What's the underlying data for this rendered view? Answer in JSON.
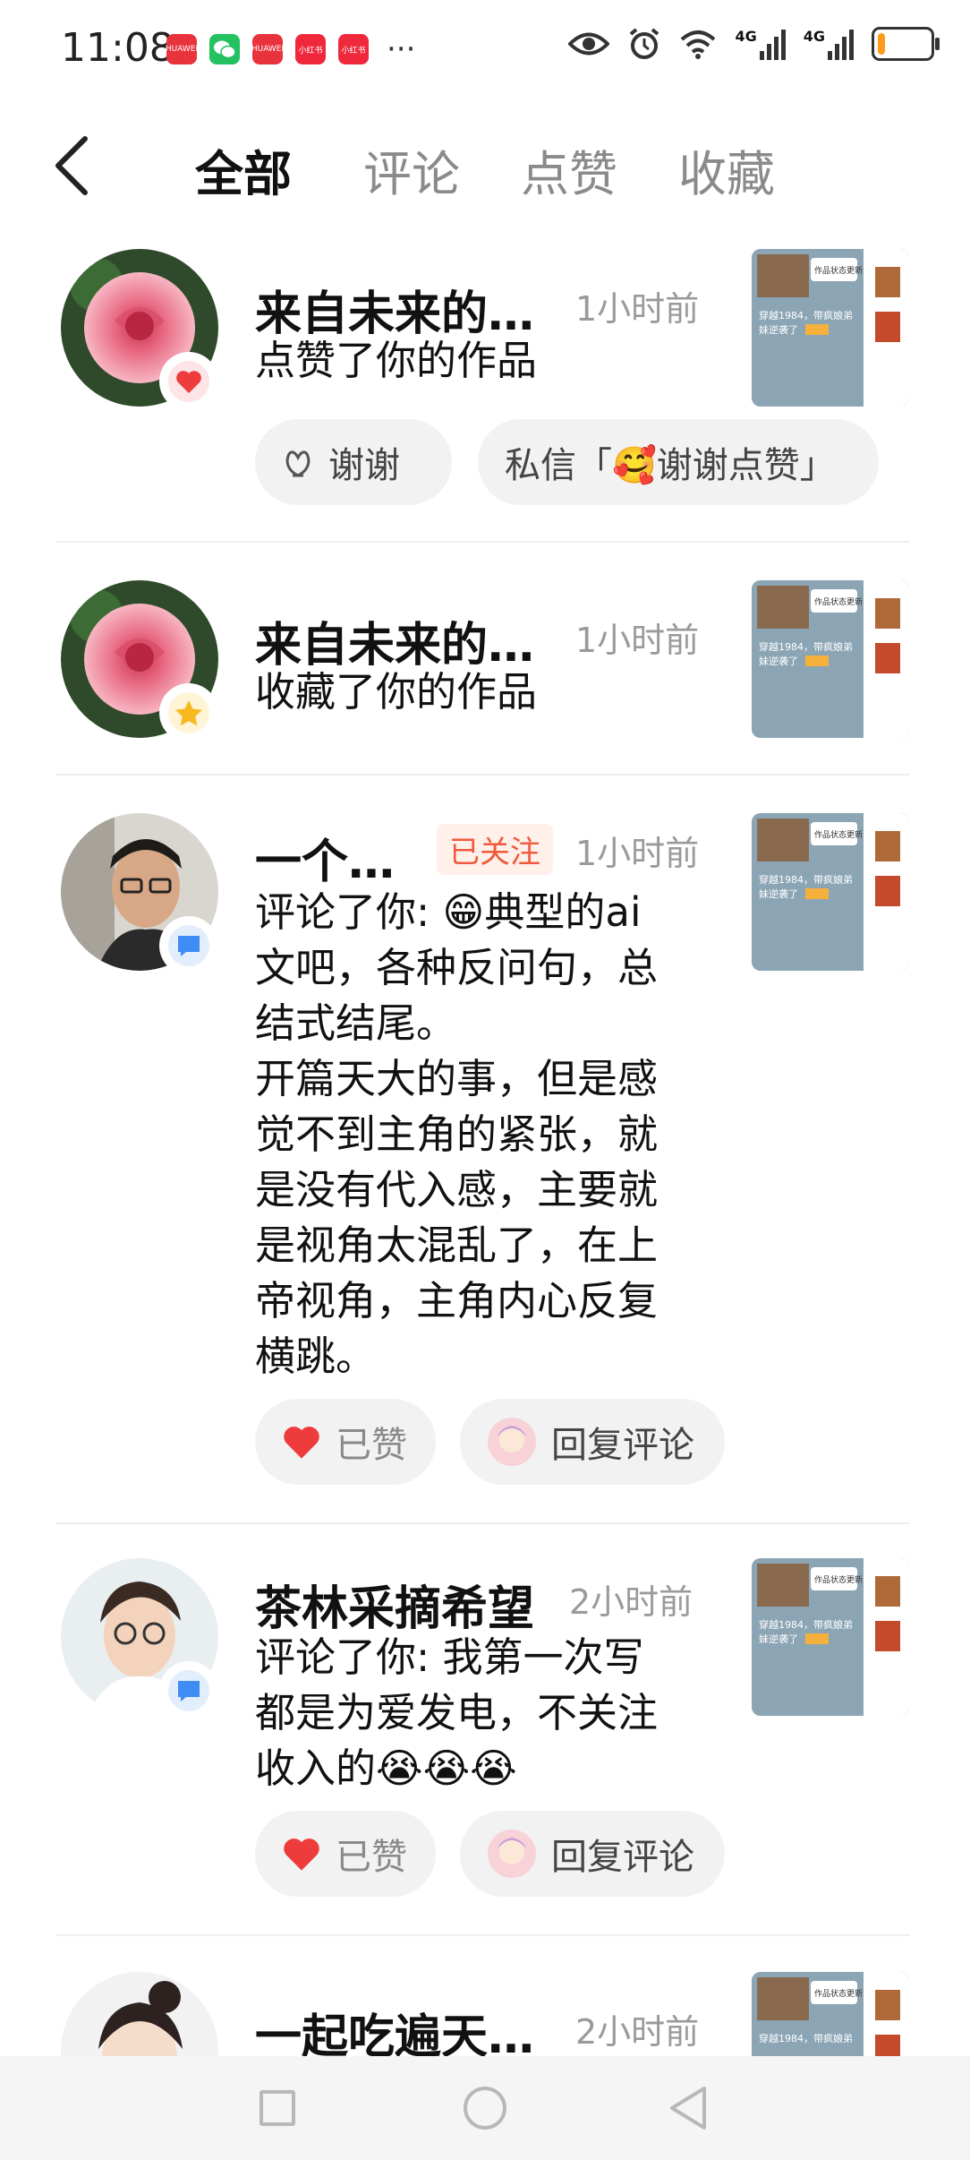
{
  "status_bar": {
    "time": "11:08",
    "app_icons": [
      {
        "name": "huawei-store-icon",
        "label": "HUAWEI",
        "color": "#e8333c"
      },
      {
        "name": "wechat-icon",
        "label": "",
        "color": "#23c160"
      },
      {
        "name": "huawei-app-icon",
        "label": "HUAWEI",
        "color": "#e8333c"
      },
      {
        "name": "xiaohongshu-icon",
        "label": "小红书",
        "color": "#f0283c"
      },
      {
        "name": "xiaohongshu-icon-2",
        "label": "小红书",
        "color": "#f0283c"
      }
    ],
    "more": "···",
    "network1": "4G",
    "network2": "4G",
    "battery_level": 0.15,
    "battery_color": "#ff9a1a"
  },
  "header": {
    "tabs": [
      "全部",
      "评论",
      "点赞",
      "收藏"
    ],
    "active_tab": 0
  },
  "notifications": [
    {
      "name": "来自未来的…",
      "time": "1小时前",
      "action": "点赞了你的作品",
      "badge": "heart-icon",
      "avatar": "rose",
      "buttons": {
        "thanks": "谢谢",
        "message": "私信「🥰谢谢点赞」"
      }
    },
    {
      "name": "来自未来的…",
      "time": "1小时前",
      "action": "收藏了你的作品",
      "badge": "star-icon",
      "avatar": "rose"
    },
    {
      "name": "一个…",
      "follow": "已关注",
      "time": "1小时前",
      "comment_lines": [
        "评论了你: 😁典型的ai",
        "文吧，各种反问句，总",
        "结式结尾。",
        "开篇天大的事，但是感",
        "觉不到主角的紧张，就",
        "是没有代入感，主要就",
        "是视角太混乱了，在上",
        "帝视角，主角内心反复",
        "横跳。"
      ],
      "badge": "comment-icon",
      "avatar": "man",
      "buttons": {
        "liked": "已赞",
        "reply": "回复评论"
      }
    },
    {
      "name": "茶林采摘希望",
      "time": "2小时前",
      "comment_lines": [
        "评论了你: 我第一次写",
        "都是为爱发电，不关注",
        "收入的😭😭😭"
      ],
      "badge": "comment-icon",
      "avatar": "cartoon-man",
      "buttons": {
        "liked": "已赞",
        "reply": "回复评论"
      }
    },
    {
      "name": "一起吃遍天…",
      "time": "2小时前",
      "avatar": "cartoon-woman"
    }
  ],
  "thumbnail": {
    "tag": "作品状态更新",
    "title": "穿越1984，带疯娘弟妹逆袭了",
    "label": "连载中"
  },
  "colors": {
    "accent_red": "#ee3b3b",
    "follow_orange": "#ef5a3c",
    "badge_blue": "#3f8cf5",
    "badge_gold": "#f7b820"
  }
}
